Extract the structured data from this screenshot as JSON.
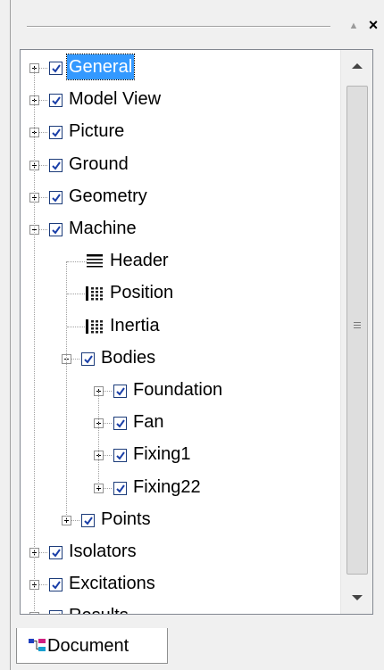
{
  "panel": {
    "pin_icon": "pin-icon",
    "close_icon": "close-icon"
  },
  "tree": {
    "items": [
      {
        "label": "General",
        "kind": "checkbox",
        "checked": true,
        "expandable": true,
        "expanded": false,
        "level": 0,
        "selected": true
      },
      {
        "label": "Model View",
        "kind": "checkbox",
        "checked": true,
        "expandable": true,
        "expanded": false,
        "level": 0
      },
      {
        "label": "Picture",
        "kind": "checkbox",
        "checked": true,
        "expandable": true,
        "expanded": false,
        "level": 0
      },
      {
        "label": "Ground",
        "kind": "checkbox",
        "checked": true,
        "expandable": true,
        "expanded": false,
        "level": 0
      },
      {
        "label": "Geometry",
        "kind": "checkbox",
        "checked": true,
        "expandable": true,
        "expanded": false,
        "level": 0
      },
      {
        "label": "Machine",
        "kind": "checkbox",
        "checked": true,
        "expandable": true,
        "expanded": true,
        "level": 0
      },
      {
        "label": "Header",
        "kind": "header-icon",
        "level": 1
      },
      {
        "label": "Position",
        "kind": "table-icon",
        "level": 1
      },
      {
        "label": "Inertia",
        "kind": "table-icon",
        "level": 1
      },
      {
        "label": "Bodies",
        "kind": "checkbox",
        "checked": true,
        "expandable": true,
        "expanded": true,
        "level": 1
      },
      {
        "label": "Foundation",
        "kind": "checkbox",
        "checked": true,
        "expandable": true,
        "expanded": false,
        "level": 2
      },
      {
        "label": "Fan",
        "kind": "checkbox",
        "checked": true,
        "expandable": true,
        "expanded": false,
        "level": 2
      },
      {
        "label": "Fixing1",
        "kind": "checkbox",
        "checked": true,
        "expandable": true,
        "expanded": false,
        "level": 2
      },
      {
        "label": "Fixing22",
        "kind": "checkbox",
        "checked": true,
        "expandable": true,
        "expanded": false,
        "level": 2
      },
      {
        "label": "Points",
        "kind": "checkbox",
        "checked": true,
        "expandable": true,
        "expanded": false,
        "level": 1
      },
      {
        "label": "Isolators",
        "kind": "checkbox",
        "checked": true,
        "expandable": true,
        "expanded": false,
        "level": 0
      },
      {
        "label": "Excitations",
        "kind": "checkbox",
        "checked": true,
        "expandable": true,
        "expanded": false,
        "level": 0
      },
      {
        "label": "Results",
        "kind": "checkbox",
        "checked": true,
        "expandable": true,
        "expanded": false,
        "level": 0
      }
    ]
  },
  "tabs": [
    {
      "label": "Document",
      "icon": "document-tree-icon",
      "active": true
    }
  ],
  "colors": {
    "selection": "#3399ff",
    "checkbox_border": "#1c3c7a",
    "check_mark": "#1a3fa8"
  }
}
